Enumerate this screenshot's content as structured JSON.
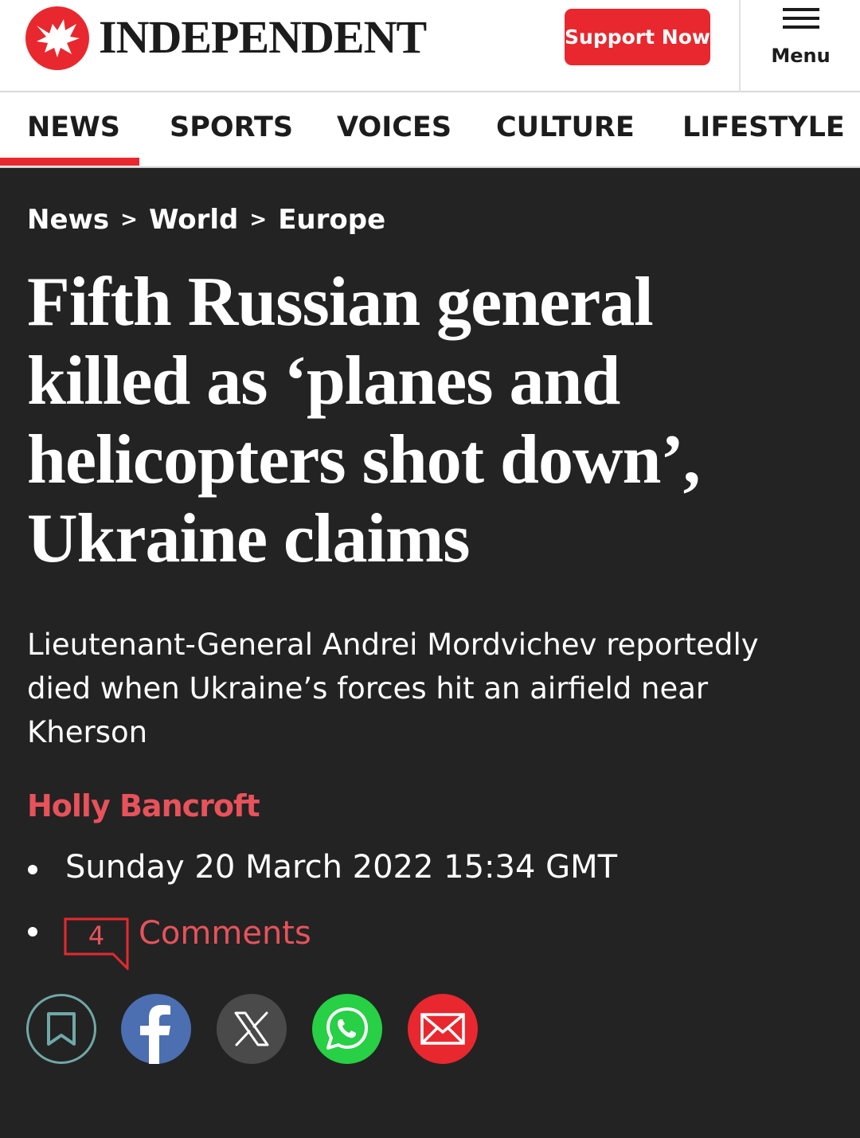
{
  "header": {
    "logo_text": "INDEPENDENT",
    "support_label": "Support Now",
    "menu_label": "Menu"
  },
  "nav": {
    "items": [
      "NEWS",
      "SPORTS",
      "VOICES",
      "CULTURE",
      "LIFESTYLE"
    ],
    "active": "NEWS"
  },
  "breadcrumb": {
    "items": [
      "News",
      "World",
      "Europe"
    ],
    "separator": ">"
  },
  "article": {
    "headline_lines": [
      "Fifth Russian general",
      "killed as ‘planes and",
      "helicopters shot down’,",
      "Ukraine claims"
    ],
    "standfirst_lines": [
      "Lieutenant-General Andrei Mordvichev reportedly",
      "died when Ukraine’s forces hit an airfield near",
      "Kherson"
    ],
    "author": "Holly Bancroft",
    "date": "Sunday 20 March 2022 15:34 GMT",
    "comments_count": "4",
    "comments_label": "Comments"
  },
  "share": {
    "icons": [
      "bookmark-icon",
      "facebook-icon",
      "x-icon",
      "whatsapp-icon",
      "email-icon"
    ]
  },
  "colors": {
    "brand_red": "#e8282e",
    "author_red": "#e8525a",
    "background": "#232323",
    "bookmark_teal": "#6fa8a6",
    "facebook_blue": "#4b6fb1",
    "whatsapp_green": "#27d045"
  }
}
